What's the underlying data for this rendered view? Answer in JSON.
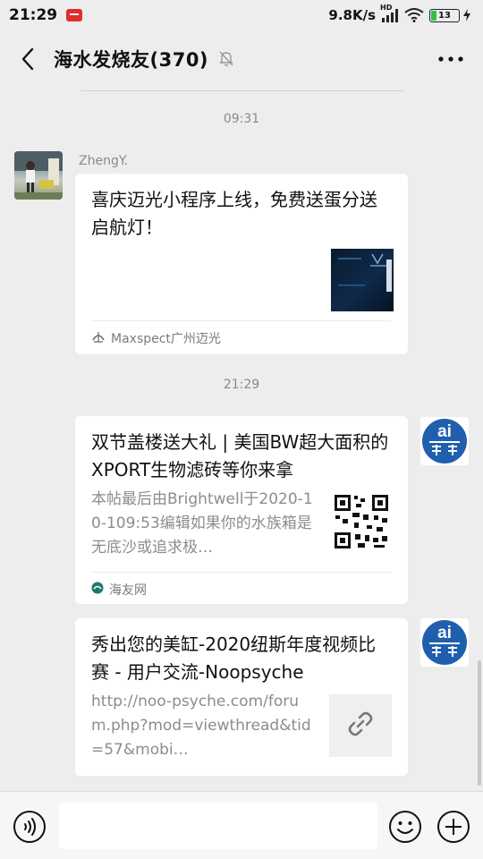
{
  "status_bar": {
    "time": "21:29",
    "net_speed": "9.8K/s",
    "signal_label": "HD",
    "battery": "13"
  },
  "header": {
    "title": "海水发烧友(370)",
    "icons": [
      "back-arrow-icon",
      "mute-bell-icon",
      "more-icon"
    ]
  },
  "chat": {
    "timestamps": [
      "09:31",
      "21:29"
    ],
    "messages": [
      {
        "sender": "ZhengY.",
        "title": "喜庆迈光小程序上线，免费送蛋分送启航灯！",
        "source": "Maxspect广州迈光",
        "thumb": "dark-product-image"
      },
      {
        "title": "双节盖楼送大礼 | 美国BW超大面积的XPORT生物滤砖等你来拿",
        "description": "本帖最后由Brightwell于2020-10-109:53编辑如果你的水族箱是无底沙或追求极…",
        "source": "海友网",
        "thumb": "qr-code"
      },
      {
        "title": "秀出您的美缸-2020纽斯年度视频比赛 - 用户交流-Noopsyche",
        "description": "http://noo-psyche.com/forum.php?mod=viewthread&tid=57&mobi…",
        "thumb": "link-icon"
      }
    ]
  },
  "input_bar": {
    "value": "",
    "icons": [
      "voice-icon",
      "emoji-icon",
      "plus-icon"
    ]
  },
  "colors": {
    "background": "#ededed",
    "card": "#ffffff",
    "secondary_text": "#8c8c8c",
    "battery_fill": "#2fbf4a"
  }
}
